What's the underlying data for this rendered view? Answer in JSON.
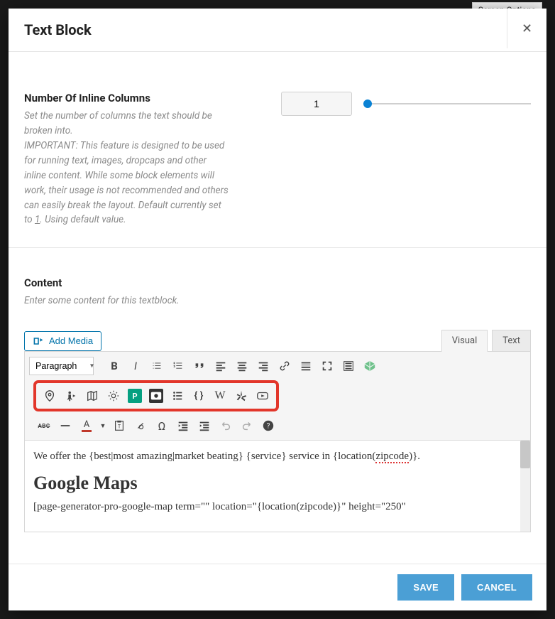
{
  "bg_hint": "Screen Options",
  "modal": {
    "title": "Text Block",
    "close_icon": "✕"
  },
  "columns_field": {
    "title": "Number Of Inline Columns",
    "desc_1": "Set the number of columns the text should be broken into.",
    "desc_2_prefix": "IMPORTANT: This feature is designed to be used for running text, images, dropcaps and other inline content. While some block elements will work, their usage is not recommended and others can easily break the layout. Default currently set to ",
    "desc_2_link": "1",
    "desc_2_suffix": ". Using default value.",
    "value": "1"
  },
  "content_field": {
    "title": "Content",
    "desc": "Enter some content for this textblock."
  },
  "editor": {
    "add_media": "Add Media",
    "tabs": {
      "visual": "Visual",
      "text": "Text"
    },
    "paragraph_label": "Paragraph",
    "content_line1_a": "We offer the {best|most amazing|market beating} {service} service in {location(",
    "content_line1_z": "zipcode",
    "content_line1_c": ")}.",
    "content_h2": "Google Maps",
    "content_line3": "[page-generator-pro-google-map term=\"\" location=\"{location(zipcode)}\" height=\"250\""
  },
  "footer": {
    "save": "SAVE",
    "cancel": "CANCEL"
  }
}
